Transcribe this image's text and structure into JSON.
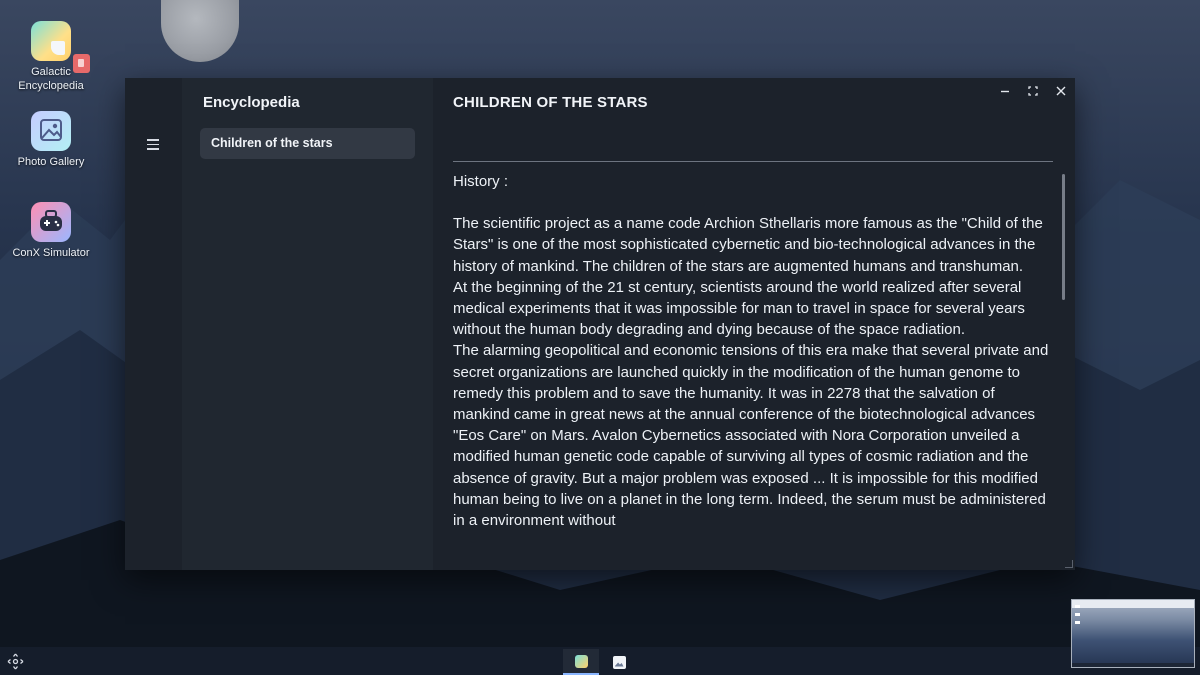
{
  "desktop": {
    "icons": [
      {
        "label": "Galactic\nEncyclopedia",
        "line1": "Galactic",
        "line2": "Encyclopedia",
        "icon": "encyclopedia-app-icon"
      },
      {
        "label": "Photo Gallery",
        "icon": "photo-gallery-app-icon"
      },
      {
        "label": "ConX Simulator",
        "icon": "gamepad-app-icon"
      }
    ]
  },
  "window": {
    "controls": {
      "minimize": "—",
      "maximize": "⛶",
      "close": "✕"
    },
    "nav": {
      "title": "Encyclopedia",
      "items": [
        {
          "label": "Children of the stars",
          "selected": true
        }
      ]
    },
    "content": {
      "title": "CHILDREN OF THE STARS",
      "section_head": "History :",
      "paragraphs": [
        "The scientific project as a name code Archion Sthellaris more famous as the \"Child of the Stars\" is one of the most sophisticated cybernetic and bio-technological advances in the history of mankind. The children of the stars are augmented humans and transhuman.",
        "At the beginning of the 21 st century, scientists around the world realized after several medical experiments that it was impossible for man to travel in space for several years without the human body degrading and dying because of the space radiation.",
        "The alarming geopolitical and economic tensions of this era make that several private and secret organizations are launched quickly in the modification of the human genome to remedy this problem and to save the humanity. It was in 2278 that the salvation of mankind came in great news at the annual conference of the biotechnological advances \"Eos Care\" on Mars. Avalon Cybernetics associated with Nora Corporation unveiled a modified human genetic code capable of surviving all types of cosmic radiation and the absence of gravity. But a major problem was exposed ... It is impossible for this modified human being to live on a planet in the long term. Indeed, the serum must be administered in a environment without"
      ]
    }
  },
  "taskbar": {
    "apps": [
      {
        "name": "Galactic Encyclopedia",
        "active": true
      },
      {
        "name": "Photo Gallery",
        "active": false
      }
    ]
  },
  "colors": {
    "window_bg": "#1c222b",
    "nav_bg": "#202730",
    "selected_item_bg": "#323944",
    "text": "#edf1f6"
  }
}
